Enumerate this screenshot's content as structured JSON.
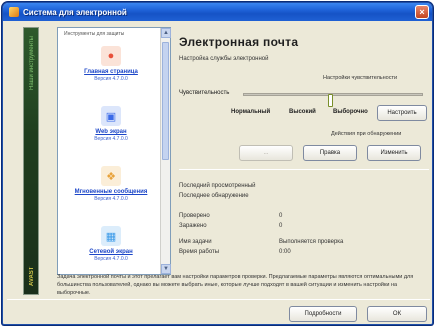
{
  "window": {
    "title": "Система для электронной",
    "close": "×"
  },
  "band": {
    "vertical_1": "AVAST",
    "vertical_2": "Наши инструменты"
  },
  "sidebar": {
    "header": "Инструменты для защиты",
    "items": [
      {
        "label": "Главная страница",
        "sub": "Версия 4.7.0.0",
        "icon": "home-icon",
        "color": "#e8503a"
      },
      {
        "label": "Web экран",
        "sub": "Версия 4.7.0.0",
        "icon": "web-shield-icon",
        "color": "#3a6ae8"
      },
      {
        "label": "Мгновенные сообщения",
        "sub": "Версия 4.7.0.0",
        "icon": "instant-messaging-icon",
        "color": "#e8a23a"
      },
      {
        "label": "Сетевой экран",
        "sub": "Версия 4.7.0.0",
        "icon": "network-shield-icon",
        "color": "#3a9ae8"
      }
    ]
  },
  "main": {
    "title": "Электронная почта",
    "subtitle": "Настройка службы электронной",
    "sensitivity_group": "Настройки чувствительности",
    "sensitivity_label": "Чувствительность",
    "presets": {
      "normal": "Нормальный",
      "high": "Высокий",
      "custom": "Выборочно"
    },
    "extended_btn": "Настроить",
    "actions_group": "Действия при обнаружении",
    "btn_disabled": "...",
    "btn_add": "Правка",
    "btn_change": "Изменить"
  },
  "info": {
    "lines": [
      {
        "label": "Последний просмотренный",
        "value": ""
      },
      {
        "label": "Последнее обнаружение",
        "value": ""
      },
      {
        "label": "Проверено",
        "value": "0"
      },
      {
        "label": "Заражено",
        "value": "0"
      },
      {
        "label": "Имя задачи",
        "value": "Выполняется проверка"
      },
      {
        "label": "Время работы",
        "value": "0:00"
      }
    ]
  },
  "description": "Задача электронной почты и этот прелагает вам настройки параметров проверки. Предлагаемые параметры являются оптимальными для большинства пользователей, однако вы можете выбрать иные, которые лучше подходят в вашей ситуации и изменить настройки на выборочные.",
  "footer": {
    "details_btn": "Подробности",
    "ok_btn": "ОК"
  },
  "colors": {
    "accent": "#1f4fa8",
    "link": "#1c46c8",
    "band": "#1f3e1e"
  }
}
